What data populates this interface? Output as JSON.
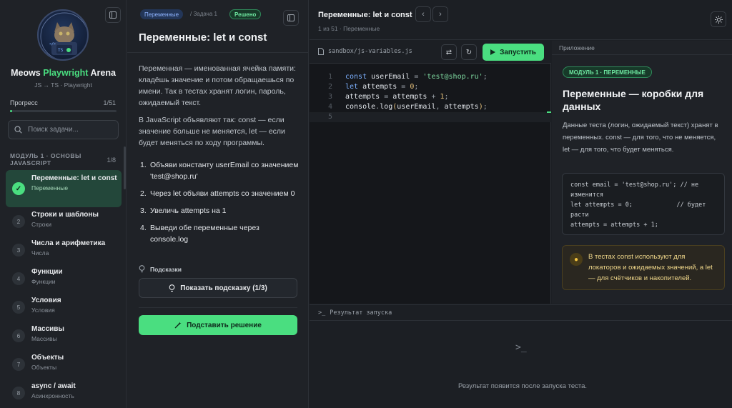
{
  "sidebar": {
    "brand_name": "Meows",
    "brand_accent": "Playwright",
    "brand_tail": "Arena",
    "brand_sub": "JS → TS · Playwright",
    "progress_label": "Прогресс",
    "progress_count": "1/51",
    "progress_value": 0.02,
    "search_placeholder": "Поиск задачи...",
    "module_title": "Модуль 1 · Основы JavaScript",
    "module_count": "1/8",
    "lessons": [
      {
        "num": "✓",
        "title": "Переменные: let и const",
        "sub": "Переменные"
      },
      {
        "num": "2",
        "title": "Строки и шаблоны",
        "sub": "Строки"
      },
      {
        "num": "3",
        "title": "Числа и арифметика",
        "sub": "Числа"
      },
      {
        "num": "4",
        "title": "Функции",
        "sub": "Функции"
      },
      {
        "num": "5",
        "title": "Условия",
        "sub": "Условия"
      },
      {
        "num": "6",
        "title": "Массивы",
        "sub": "Массивы"
      },
      {
        "num": "7",
        "title": "Объекты",
        "sub": "Объекты"
      },
      {
        "num": "8",
        "title": "async / await",
        "sub": "Асинхронность"
      }
    ]
  },
  "task": {
    "topic_tag": "Переменные",
    "slash_label": "/ Задача 1",
    "status": "Решено",
    "title": "Переменные: let и const",
    "desc_1": "Переменная — именованная ячейка памяти: кладёшь значение и потом обращаешься по имени. Так в тестах хранят логин, пароль, ожидаемый текст.",
    "desc_2": "В JavaScript объявляют так: const — если значение больше не меняется, let — если будет меняться по ходу программы.",
    "steps": [
      "Объяви константу userEmail со значением 'test@shop.ru'",
      "Через let объяви attempts со значением 0",
      "Увеличь attempts на 1",
      "Выведи обе переменные через console.log"
    ],
    "hints_label": "Подсказки",
    "hint_button": "Показать подсказку (1/3)",
    "solve_button": "Подставить решение"
  },
  "topbar": {
    "title": "Переменные: let и const",
    "subtitle": "1 из 51 · Переменные"
  },
  "editor": {
    "file": "sandbox/js-variables.js",
    "run_button": "Запустить",
    "line_numbers": [
      "1",
      "2",
      "3",
      "4",
      "5"
    ]
  },
  "output": {
    "title": "Результат запуска",
    "prompt": ">_",
    "empty": "Результат появится после запуска теста."
  },
  "appendix": {
    "header": "Приложение",
    "badge": "МОДУЛЬ 1 · ПЕРЕМЕННЫЕ",
    "title": "Переменные — коробки для данных",
    "text": "Данные теста (логин, ожидаемый текст) хранят в переменных. const — для того, что не меняется, let — для того, что будет меняться.",
    "code": "const email = 'test@shop.ru'; // не изменится\nlet attempts = 0;            // будет расти\nattempts = attempts + 1;",
    "tip": "В тестах const используют для локаторов и ожидаемых значений, а let — для счётчиков и накопителей."
  },
  "colors": {
    "accent": "#4ade80",
    "topic": "#8fb4ff",
    "tip": "#f0d78a"
  }
}
